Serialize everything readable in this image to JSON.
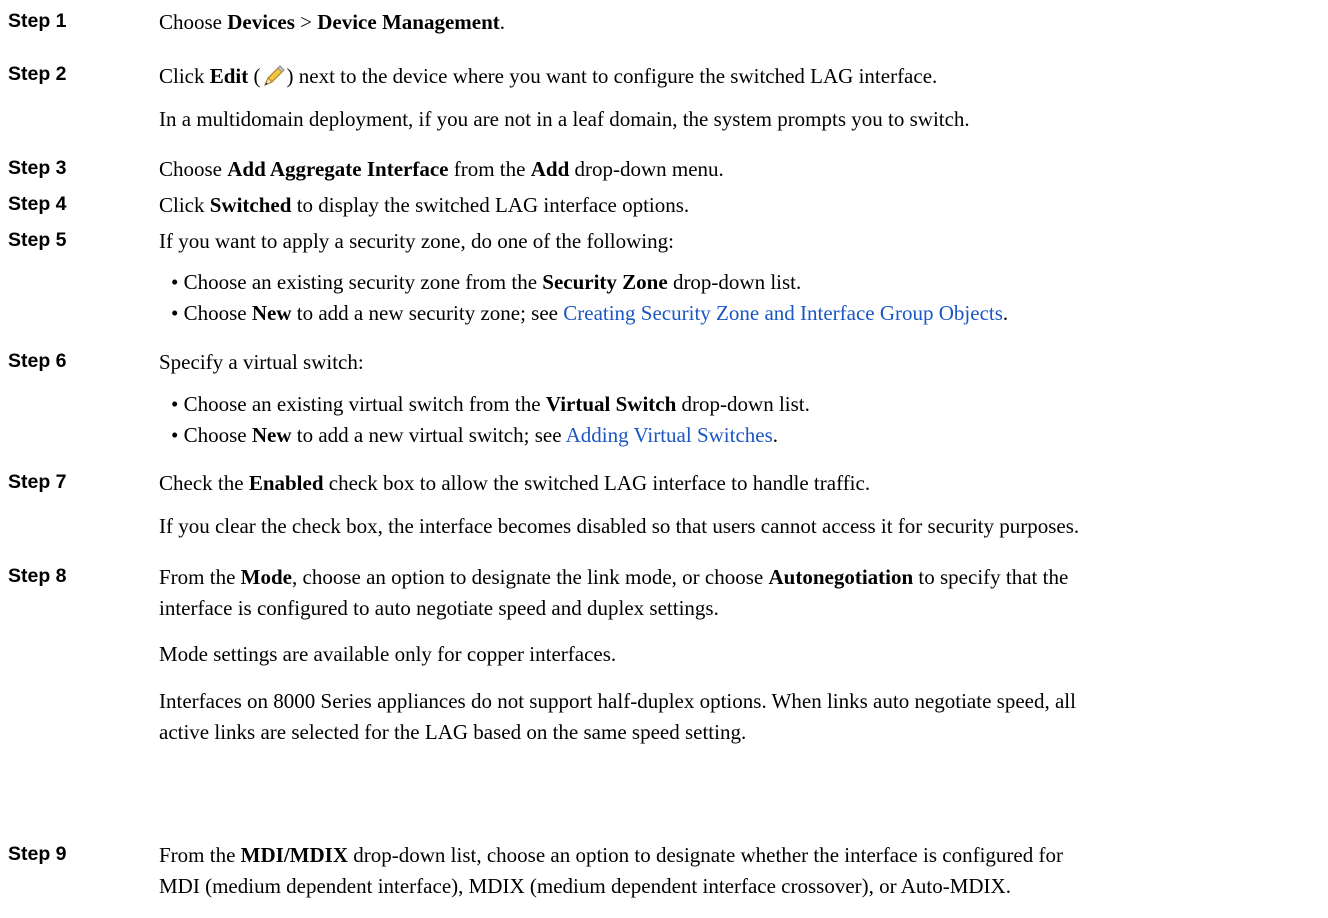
{
  "steps": [
    {
      "label": "Step 1",
      "text": [
        "Choose ",
        "Devices",
        " > ",
        "Device Management",
        "."
      ]
    },
    {
      "label": "Step 2",
      "text": [
        "Click ",
        "Edit",
        " (",
        ") next to the device where you want to configure the switched LAG interface."
      ],
      "note": "In a multidomain deployment, if you are not in a leaf domain, the system prompts you to switch.",
      "icon": "pencil-edit-icon"
    },
    {
      "label": "Step 3",
      "text": [
        "Choose ",
        "Add Aggregate Interface",
        " from the ",
        "Add",
        " drop-down menu."
      ]
    },
    {
      "label": "Step 4",
      "text": [
        "Click ",
        "Switched",
        " to display the switched LAG interface options."
      ]
    },
    {
      "label": "Step 5",
      "text": "If you want to apply a security zone, do one of the following:",
      "bullets": [
        {
          "parts": [
            "Choose an existing security zone from the ",
            "Security Zone",
            " drop-down list."
          ]
        },
        {
          "parts": [
            "Choose ",
            "New",
            " to add a new security zone; see ",
            "Creating Security Zone and Interface Group Objects",
            "."
          ]
        }
      ]
    },
    {
      "label": "Step 6",
      "text": "Specify a virtual switch:",
      "bullets": [
        {
          "parts": [
            "Choose an existing virtual switch from the ",
            "Virtual Switch",
            " drop-down list."
          ]
        },
        {
          "parts": [
            "Choose ",
            "New",
            " to add a new virtual switch; see ",
            "Adding Virtual Switches",
            "."
          ]
        }
      ]
    },
    {
      "label": "Step 7",
      "text": [
        "Check the ",
        "Enabled",
        " check box to allow the switched LAG interface to handle traffic."
      ],
      "note": "If you clear the check box, the interface becomes disabled so that users cannot access it for security purposes."
    },
    {
      "label": "Step 8",
      "text": [
        "From the ",
        "Mode",
        ", choose an option to designate the link mode, or choose ",
        "Autonegotiation",
        " to specify that the"
      ],
      "text2": "interface is configured to auto negotiate speed and duplex settings.",
      "note": "Mode settings are available only for copper interfaces.",
      "note2a": "Interfaces on 8000 Series appliances do not support half-duplex options. When links auto negotiate speed, all",
      "note2b": "active links are selected for the LAG based on the same speed setting."
    },
    {
      "label": "Step 9",
      "text": [
        "From the ",
        "MDI/MDIX",
        " drop-down list, choose an option to designate whether the interface is configured for"
      ],
      "text2": "MDI (medium dependent interface), MDIX (medium dependent interface crossover), or Auto-MDIX."
    }
  ],
  "colors": {
    "link": "#1a56c4",
    "text": "#000000"
  }
}
